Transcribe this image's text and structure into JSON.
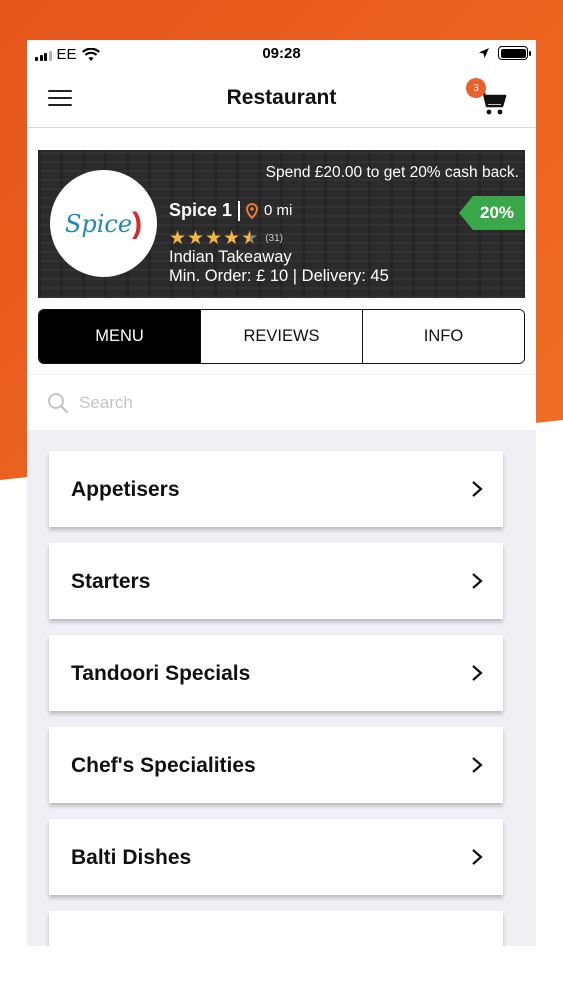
{
  "status_bar": {
    "carrier": "EE",
    "time": "09:28"
  },
  "nav": {
    "title": "Restaurant",
    "cart_count": "3"
  },
  "banner": {
    "promo": "Spend £20.00 to get 20% cash back.",
    "logo_text": "Spice",
    "name": "Spice 1",
    "distance": "0 mi",
    "rating": 4.5,
    "rating_count": "(31)",
    "cuisine": "Indian Takeaway",
    "min_order": "Min. Order: £ 10 | Delivery: 45",
    "discount": "20%"
  },
  "tabs": [
    {
      "label": "MENU",
      "active": true
    },
    {
      "label": "REVIEWS",
      "active": false
    },
    {
      "label": "INFO",
      "active": false
    }
  ],
  "search": {
    "placeholder": "Search"
  },
  "categories": [
    {
      "label": "Appetisers"
    },
    {
      "label": "Starters"
    },
    {
      "label": "Tandoori Specials"
    },
    {
      "label": "Chef's Specialities"
    },
    {
      "label": "Balti Dishes"
    }
  ],
  "colors": {
    "accent_orange": "#e9602a",
    "discount_green": "#3aa84a",
    "star_gold": "#f6b73c"
  }
}
